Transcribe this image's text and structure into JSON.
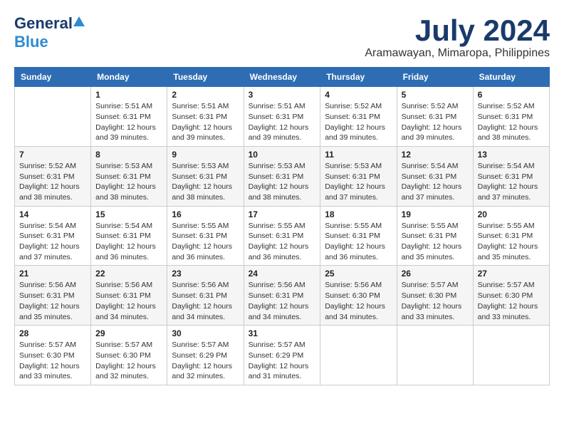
{
  "header": {
    "logo_general": "General",
    "logo_blue": "Blue",
    "month_title": "July 2024",
    "location": "Aramawayan, Mimaropa, Philippines"
  },
  "weekdays": [
    "Sunday",
    "Monday",
    "Tuesday",
    "Wednesday",
    "Thursday",
    "Friday",
    "Saturday"
  ],
  "weeks": [
    [
      {
        "day": "",
        "info": ""
      },
      {
        "day": "1",
        "info": "Sunrise: 5:51 AM\nSunset: 6:31 PM\nDaylight: 12 hours\nand 39 minutes."
      },
      {
        "day": "2",
        "info": "Sunrise: 5:51 AM\nSunset: 6:31 PM\nDaylight: 12 hours\nand 39 minutes."
      },
      {
        "day": "3",
        "info": "Sunrise: 5:51 AM\nSunset: 6:31 PM\nDaylight: 12 hours\nand 39 minutes."
      },
      {
        "day": "4",
        "info": "Sunrise: 5:52 AM\nSunset: 6:31 PM\nDaylight: 12 hours\nand 39 minutes."
      },
      {
        "day": "5",
        "info": "Sunrise: 5:52 AM\nSunset: 6:31 PM\nDaylight: 12 hours\nand 39 minutes."
      },
      {
        "day": "6",
        "info": "Sunrise: 5:52 AM\nSunset: 6:31 PM\nDaylight: 12 hours\nand 38 minutes."
      }
    ],
    [
      {
        "day": "7",
        "info": "Sunrise: 5:52 AM\nSunset: 6:31 PM\nDaylight: 12 hours\nand 38 minutes."
      },
      {
        "day": "8",
        "info": "Sunrise: 5:53 AM\nSunset: 6:31 PM\nDaylight: 12 hours\nand 38 minutes."
      },
      {
        "day": "9",
        "info": "Sunrise: 5:53 AM\nSunset: 6:31 PM\nDaylight: 12 hours\nand 38 minutes."
      },
      {
        "day": "10",
        "info": "Sunrise: 5:53 AM\nSunset: 6:31 PM\nDaylight: 12 hours\nand 38 minutes."
      },
      {
        "day": "11",
        "info": "Sunrise: 5:53 AM\nSunset: 6:31 PM\nDaylight: 12 hours\nand 37 minutes."
      },
      {
        "day": "12",
        "info": "Sunrise: 5:54 AM\nSunset: 6:31 PM\nDaylight: 12 hours\nand 37 minutes."
      },
      {
        "day": "13",
        "info": "Sunrise: 5:54 AM\nSunset: 6:31 PM\nDaylight: 12 hours\nand 37 minutes."
      }
    ],
    [
      {
        "day": "14",
        "info": "Sunrise: 5:54 AM\nSunset: 6:31 PM\nDaylight: 12 hours\nand 37 minutes."
      },
      {
        "day": "15",
        "info": "Sunrise: 5:54 AM\nSunset: 6:31 PM\nDaylight: 12 hours\nand 36 minutes."
      },
      {
        "day": "16",
        "info": "Sunrise: 5:55 AM\nSunset: 6:31 PM\nDaylight: 12 hours\nand 36 minutes."
      },
      {
        "day": "17",
        "info": "Sunrise: 5:55 AM\nSunset: 6:31 PM\nDaylight: 12 hours\nand 36 minutes."
      },
      {
        "day": "18",
        "info": "Sunrise: 5:55 AM\nSunset: 6:31 PM\nDaylight: 12 hours\nand 36 minutes."
      },
      {
        "day": "19",
        "info": "Sunrise: 5:55 AM\nSunset: 6:31 PM\nDaylight: 12 hours\nand 35 minutes."
      },
      {
        "day": "20",
        "info": "Sunrise: 5:55 AM\nSunset: 6:31 PM\nDaylight: 12 hours\nand 35 minutes."
      }
    ],
    [
      {
        "day": "21",
        "info": "Sunrise: 5:56 AM\nSunset: 6:31 PM\nDaylight: 12 hours\nand 35 minutes."
      },
      {
        "day": "22",
        "info": "Sunrise: 5:56 AM\nSunset: 6:31 PM\nDaylight: 12 hours\nand 34 minutes."
      },
      {
        "day": "23",
        "info": "Sunrise: 5:56 AM\nSunset: 6:31 PM\nDaylight: 12 hours\nand 34 minutes."
      },
      {
        "day": "24",
        "info": "Sunrise: 5:56 AM\nSunset: 6:31 PM\nDaylight: 12 hours\nand 34 minutes."
      },
      {
        "day": "25",
        "info": "Sunrise: 5:56 AM\nSunset: 6:30 PM\nDaylight: 12 hours\nand 34 minutes."
      },
      {
        "day": "26",
        "info": "Sunrise: 5:57 AM\nSunset: 6:30 PM\nDaylight: 12 hours\nand 33 minutes."
      },
      {
        "day": "27",
        "info": "Sunrise: 5:57 AM\nSunset: 6:30 PM\nDaylight: 12 hours\nand 33 minutes."
      }
    ],
    [
      {
        "day": "28",
        "info": "Sunrise: 5:57 AM\nSunset: 6:30 PM\nDaylight: 12 hours\nand 33 minutes."
      },
      {
        "day": "29",
        "info": "Sunrise: 5:57 AM\nSunset: 6:30 PM\nDaylight: 12 hours\nand 32 minutes."
      },
      {
        "day": "30",
        "info": "Sunrise: 5:57 AM\nSunset: 6:29 PM\nDaylight: 12 hours\nand 32 minutes."
      },
      {
        "day": "31",
        "info": "Sunrise: 5:57 AM\nSunset: 6:29 PM\nDaylight: 12 hours\nand 31 minutes."
      },
      {
        "day": "",
        "info": ""
      },
      {
        "day": "",
        "info": ""
      },
      {
        "day": "",
        "info": ""
      }
    ]
  ]
}
